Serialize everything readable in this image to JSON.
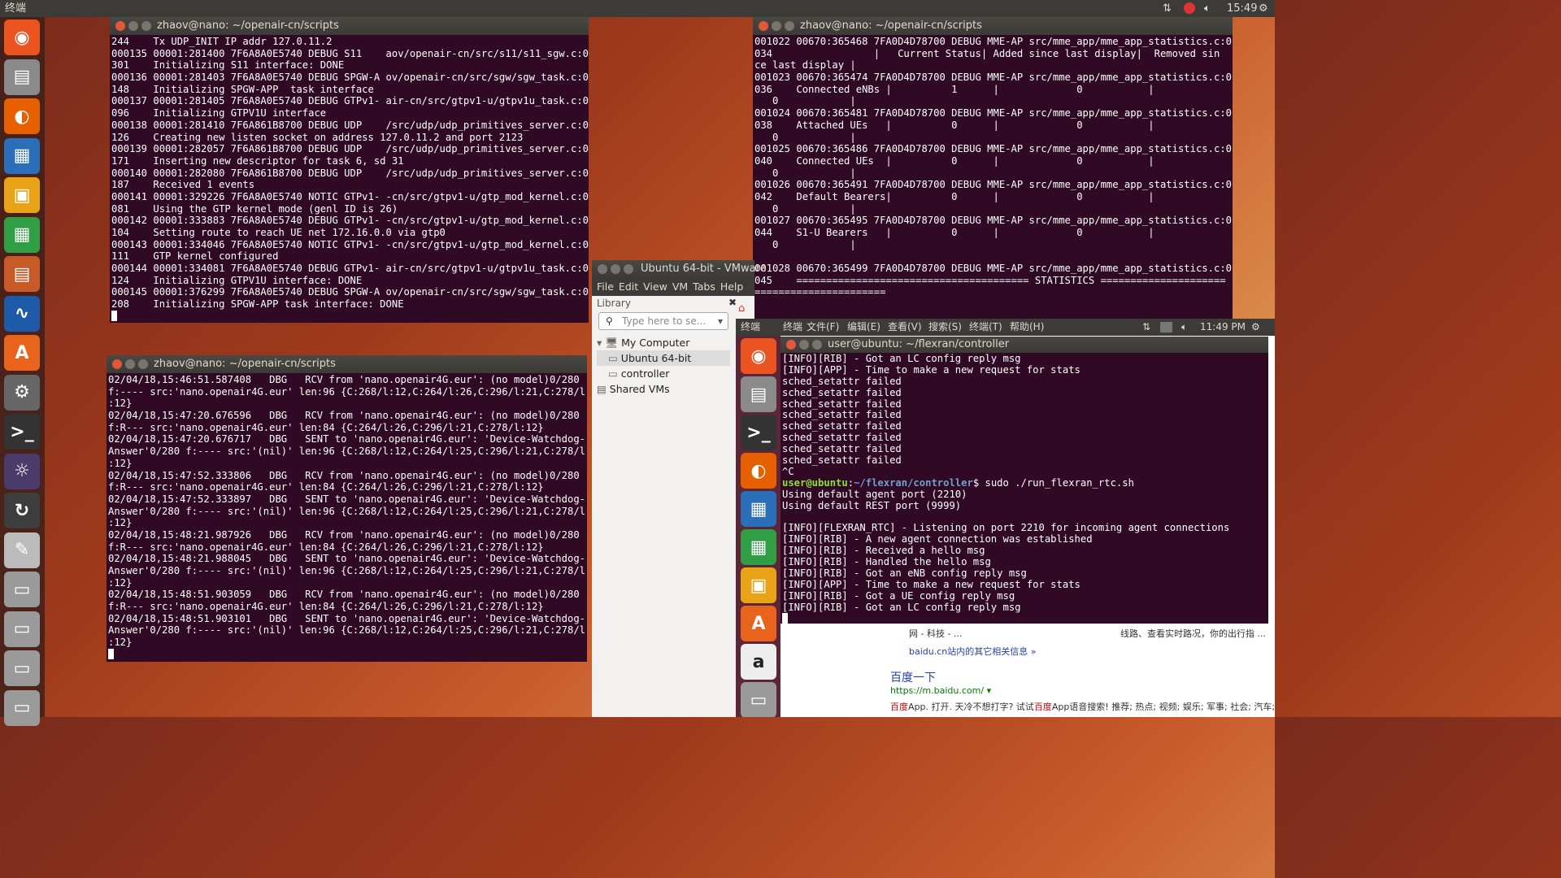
{
  "topbar": {
    "title": "终端",
    "clock": "15:49"
  },
  "launcher": {
    "items": [
      "ubuntu-icon",
      "files-icon",
      "firefox-icon",
      "writer-icon",
      "impress-icon",
      "calc-icon",
      "viewer-icon",
      "wireshark-icon",
      "software-center-icon",
      "settings-icon",
      "terminal-icon",
      "javaee-ide-icon",
      "updater-icon",
      "text-editor-icon",
      "drive-icon",
      "drive-icon",
      "drive-icon",
      "drive-icon"
    ]
  },
  "term_top_left": {
    "title": "zhaov@nano: ~/openair-cn/scripts",
    "lines": [
      "244    Tx UDP_INIT IP addr 127.0.11.2",
      "000135 00001:281400 7F6A8A0E5740 DEBUG S11    aov/openair-cn/src/s11/s11_sgw.c:0",
      "301    Initializing S11 interface: DONE",
      "000136 00001:281403 7F6A8A0E5740 DEBUG SPGW-A ov/openair-cn/src/sgw/sgw_task.c:0",
      "148    Initializing SPGW-APP  task interface",
      "000137 00001:281405 7F6A8A0E5740 DEBUG GTPv1- air-cn/src/gtpv1-u/gtpv1u_task.c:0",
      "096    Initializing GTPV1U interface",
      "000138 00001:281410 7F6A861B8700 DEBUG UDP    /src/udp/udp_primitives_server.c:0",
      "126    Creating new listen socket on address 127.0.11.2 and port 2123",
      "000139 00001:282057 7F6A861B8700 DEBUG UDP    /src/udp/udp_primitives_server.c:0",
      "171    Inserting new descriptor for task 6, sd 31",
      "000140 00001:282080 7F6A861B8700 DEBUG UDP    /src/udp/udp_primitives_server.c:0",
      "187    Received 1 events",
      "000141 00001:329226 7F6A8A0E5740 NOTIC GTPv1- -cn/src/gtpv1-u/gtp_mod_kernel.c:0",
      "081    Using the GTP kernel mode (genl ID is 26)",
      "000142 00001:333883 7F6A8A0E5740 DEBUG GTPv1- -cn/src/gtpv1-u/gtp_mod_kernel.c:0",
      "104    Setting route to reach UE net 172.16.0.0 via gtp0",
      "000143 00001:334046 7F6A8A0E5740 NOTIC GTPv1- -cn/src/gtpv1-u/gtp_mod_kernel.c:0",
      "111    GTP kernel configured",
      "000144 00001:334081 7F6A8A0E5740 DEBUG GTPv1- air-cn/src/gtpv1-u/gtpv1u_task.c:0",
      "124    Initializing GTPV1U interface: DONE",
      "000145 00001:376299 7F6A8A0E5740 DEBUG SPGW-A ov/openair-cn/src/sgw/sgw_task.c:0",
      "208    Initializing SPGW-APP task interface: DONE"
    ]
  },
  "term_top_right": {
    "title": "zhaov@nano: ~/openair-cn/scripts",
    "lines": [
      "001022 00670:365468 7FA0D4D78700 DEBUG MME-AP src/mme_app/mme_app_statistics.c:0",
      "034                 |   Current Status| Added since last display|  Removed sin",
      "ce last display |",
      "001023 00670:365474 7FA0D4D78700 DEBUG MME-AP src/mme_app/mme_app_statistics.c:0",
      "036    Connected eNBs |          1      |             0           |",
      "   0            |",
      "001024 00670:365481 7FA0D4D78700 DEBUG MME-AP src/mme_app/mme_app_statistics.c:0",
      "038    Attached UEs   |          0      |             0           |",
      "   0            |",
      "001025 00670:365486 7FA0D4D78700 DEBUG MME-AP src/mme_app/mme_app_statistics.c:0",
      "040    Connected UEs  |          0      |             0           |",
      "   0            |",
      "001026 00670:365491 7FA0D4D78700 DEBUG MME-AP src/mme_app/mme_app_statistics.c:0",
      "042    Default Bearers|          0      |             0           |",
      "   0            |",
      "001027 00670:365495 7FA0D4D78700 DEBUG MME-AP src/mme_app/mme_app_statistics.c:0",
      "044    S1-U Bearers   |          0      |             0           |",
      "   0            |",
      "",
      "001028 00670:365499 7FA0D4D78700 DEBUG MME-AP src/mme_app/mme_app_statistics.c:0",
      "045    ======================================= STATISTICS =====================",
      "======================"
    ]
  },
  "term_bottom_left": {
    "title": "zhaov@nano: ~/openair-cn/scripts",
    "lines": [
      "02/04/18,15:46:51.587408   DBG   RCV from 'nano.openair4G.eur': (no model)0/280",
      "f:---- src:'nano.openair4G.eur' len:96 {C:268/l:12,C:264/l:26,C:296/l:21,C:278/l",
      ":12}",
      "02/04/18,15:47:20.676596   DBG   RCV from 'nano.openair4G.eur': (no model)0/280",
      "f:R--- src:'nano.openair4G.eur' len:84 {C:264/l:26,C:296/l:21,C:278/l:12}",
      "02/04/18,15:47:20.676717   DBG   SENT to 'nano.openair4G.eur': 'Device-Watchdog-",
      "Answer'0/280 f:---- src:'(nil)' len:96 {C:268/l:12,C:264/l:25,C:296/l:21,C:278/l",
      ":12}",
      "02/04/18,15:47:52.333806   DBG   RCV from 'nano.openair4G.eur': (no model)0/280",
      "f:R--- src:'nano.openair4G.eur' len:84 {C:264/l:26,C:296/l:21,C:278/l:12}",
      "02/04/18,15:47:52.333897   DBG   SENT to 'nano.openair4G.eur': 'Device-Watchdog-",
      "Answer'0/280 f:---- src:'(nil)' len:96 {C:268/l:12,C:264/l:25,C:296/l:21,C:278/l",
      ":12}",
      "02/04/18,15:48:21.987926   DBG   RCV from 'nano.openair4G.eur': (no model)0/280",
      "f:R--- src:'nano.openair4G.eur' len:84 {C:264/l:26,C:296/l:21,C:278/l:12}",
      "02/04/18,15:48:21.988045   DBG   SENT to 'nano.openair4G.eur': 'Device-Watchdog-",
      "Answer'0/280 f:---- src:'(nil)' len:96 {C:268/l:12,C:264/l:25,C:296/l:21,C:278/l",
      ":12}",
      "02/04/18,15:48:51.903059   DBG   RCV from 'nano.openair4G.eur': (no model)0/280",
      "f:R--- src:'nano.openair4G.eur' len:84 {C:264/l:26,C:296/l:21,C:278/l:12}",
      "02/04/18,15:48:51.903101   DBG   SENT to 'nano.openair4G.eur': 'Device-Watchdog-",
      "Answer'0/280 f:---- src:'(nil)' len:96 {C:268/l:12,C:264/l:25,C:296/l:21,C:278/l",
      ":12}"
    ]
  },
  "vmware": {
    "title": "Ubuntu 64-bit - VMware",
    "menu": [
      "File",
      "Edit",
      "View",
      "VM",
      "Tabs",
      "Help"
    ],
    "library_label": "Library",
    "search_placeholder": "Type here to se...",
    "tree": [
      "My Computer",
      "Ubuntu 64-bit",
      "controller",
      "Shared VMs"
    ]
  },
  "guest": {
    "topbar_title": "终端",
    "menu": [
      "终端",
      "文件(F)",
      "编辑(E)",
      "查看(V)",
      "搜索(S)",
      "终端(T)",
      "帮助(H)"
    ],
    "clock": "11:49 PM",
    "term": {
      "title": "user@ubuntu: ~/flexran/controller",
      "lines_before": [
        "[INFO][RIB] - Got an LC config reply msg",
        "[INFO][APP] - Time to make a new request for stats",
        "sched_setattr failed",
        "sched_setattr failed",
        "sched_setattr failed",
        "sched_setattr failed",
        "sched_setattr failed",
        "sched_setattr failed",
        "sched_setattr failed",
        "sched_setattr failed",
        "^C"
      ],
      "prompt_user": "user@ubuntu",
      "prompt_sep": ":",
      "prompt_path": "~/flexran/controller",
      "prompt_cmd": "$ sudo ./run_flexran_rtc.sh",
      "lines_after": [
        "Using default agent port (2210)",
        "Using default REST port (9999)",
        "",
        "[INFO][FLEXRAN_RTC] - Listening on port 2210 for incoming agent connections",
        "[INFO][RIB] - A new agent connection was established",
        "[INFO][RIB] - Received a hello msg",
        "[INFO][RIB] - Handled the hello msg",
        "[INFO][RIB] - Got an eNB config reply msg",
        "[INFO][APP] - Time to make a new request for stats",
        "[INFO][RIB] - Got a UE config reply msg",
        "[INFO][RIB] - Got an LC config reply msg"
      ]
    },
    "browser": {
      "snippet1": "网 - 科技 - ...",
      "snippet2": "线路、查看实时路况，你的出行指 ...",
      "more": "baidu.cn站内的其它相关信息 »",
      "result_title": "百度一下",
      "result_url": "https://m.baidu.com/ ▾",
      "desc_hl1": "百度",
      "desc1": "App. 打开. 天冷不想打字? 试试",
      "desc_hl2": "百度",
      "desc2": "App语音搜索! 推荐; 热点; 视频; 娱乐; 军事; 社会; 汽车;"
    }
  }
}
